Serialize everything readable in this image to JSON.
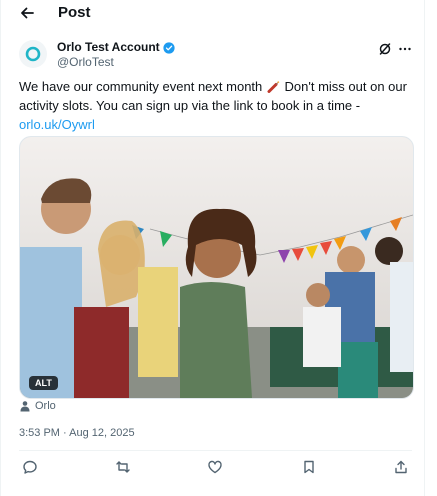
{
  "header": {
    "title": "Post"
  },
  "author": {
    "display_name": "Orlo Test Account",
    "handle": "@OrloTest"
  },
  "tweet": {
    "text": "We have our community event next month",
    "text_after_emoji": "Don't miss out on our activity slots. You can sign up via the link to book in a time -",
    "link": "orlo.uk/Oywrl",
    "emoji": "firecracker-emoji"
  },
  "media": {
    "alt_badge": "ALT",
    "description_icon": "photo"
  },
  "source": {
    "label": "Orlo"
  },
  "meta": {
    "timestamp": "3:53 PM · Aug 12, 2025"
  },
  "colors": {
    "link": "#1d9bf0",
    "verified": "#1d9bf0",
    "secondary_text": "#536471"
  },
  "icons": {
    "back": "arrow-left-icon",
    "verified": "verified-badge-icon",
    "grok": "grok-icon",
    "more": "more-icon",
    "reply": "reply-icon",
    "repost": "repost-icon",
    "like": "heart-icon",
    "bookmark": "bookmark-icon",
    "share": "share-icon"
  }
}
